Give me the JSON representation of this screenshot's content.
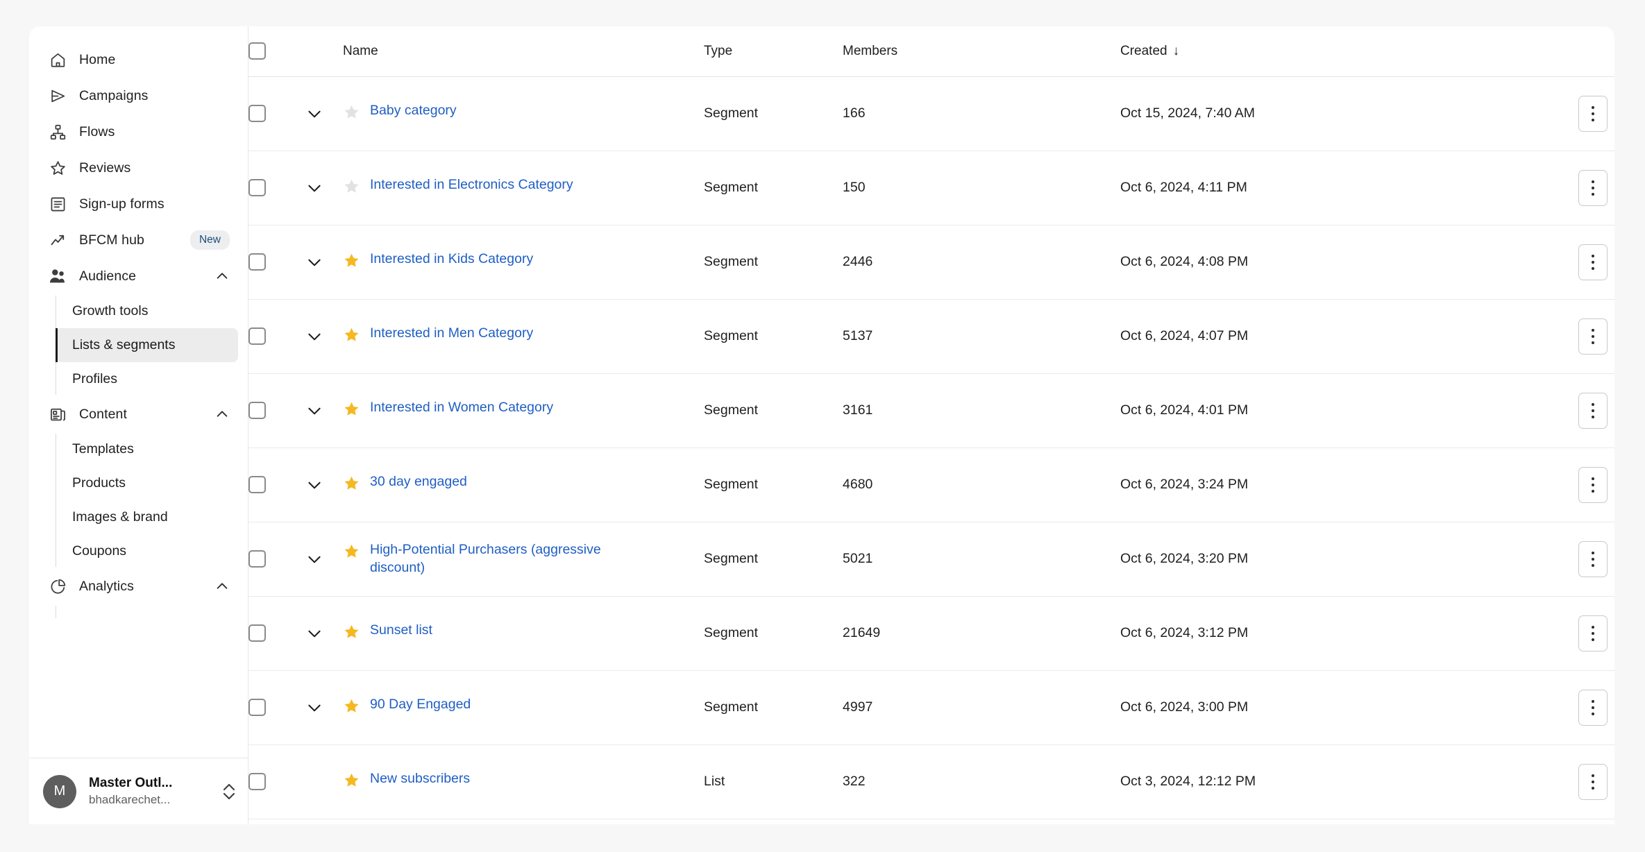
{
  "sidebar": {
    "items": [
      {
        "label": "Home",
        "icon": "home-icon"
      },
      {
        "label": "Campaigns",
        "icon": "campaigns-icon"
      },
      {
        "label": "Flows",
        "icon": "flows-icon"
      },
      {
        "label": "Reviews",
        "icon": "reviews-star-icon"
      },
      {
        "label": "Sign-up forms",
        "icon": "signup-forms-icon"
      },
      {
        "label": "BFCM hub",
        "icon": "trending-up-icon",
        "badge": "New"
      }
    ],
    "groups": [
      {
        "label": "Audience",
        "icon": "audience-people-icon",
        "expanded": true,
        "children": [
          {
            "label": "Growth tools",
            "active": false
          },
          {
            "label": "Lists & segments",
            "active": true
          },
          {
            "label": "Profiles",
            "active": false
          }
        ]
      },
      {
        "label": "Content",
        "icon": "content-icon",
        "expanded": true,
        "children": [
          {
            "label": "Templates",
            "active": false
          },
          {
            "label": "Products",
            "active": false
          },
          {
            "label": "Images & brand",
            "active": false
          },
          {
            "label": "Coupons",
            "active": false
          }
        ]
      },
      {
        "label": "Analytics",
        "icon": "analytics-pie-icon",
        "expanded": true,
        "children": []
      }
    ],
    "account": {
      "avatar_initial": "M",
      "name": "Master Outl...",
      "email": "bhadkarechet..."
    }
  },
  "table": {
    "columns": {
      "name": "Name",
      "type": "Type",
      "members": "Members",
      "created": "Created",
      "sort_arrow": "↓"
    },
    "rows": [
      {
        "name": "Baby category",
        "starred": false,
        "has_chevron": true,
        "type": "Segment",
        "members": "166",
        "created": "Oct 15, 2024, 7:40 AM"
      },
      {
        "name": "Interested in Electronics Category",
        "starred": false,
        "has_chevron": true,
        "type": "Segment",
        "members": "150",
        "created": "Oct 6, 2024, 4:11 PM"
      },
      {
        "name": "Interested in Kids Category",
        "starred": true,
        "has_chevron": true,
        "type": "Segment",
        "members": "2446",
        "created": "Oct 6, 2024, 4:08 PM"
      },
      {
        "name": "Interested in Men Category",
        "starred": true,
        "has_chevron": true,
        "type": "Segment",
        "members": "5137",
        "created": "Oct 6, 2024, 4:07 PM"
      },
      {
        "name": "Interested in Women Category",
        "starred": true,
        "has_chevron": true,
        "type": "Segment",
        "members": "3161",
        "created": "Oct 6, 2024, 4:01 PM"
      },
      {
        "name": "30 day engaged",
        "starred": true,
        "has_chevron": true,
        "type": "Segment",
        "members": "4680",
        "created": "Oct 6, 2024, 3:24 PM"
      },
      {
        "name": "High-Potential Purchasers (aggressive discount)",
        "starred": true,
        "has_chevron": true,
        "type": "Segment",
        "members": "5021",
        "created": "Oct 6, 2024, 3:20 PM"
      },
      {
        "name": "Sunset list",
        "starred": true,
        "has_chevron": true,
        "type": "Segment",
        "members": "21649",
        "created": "Oct 6, 2024, 3:12 PM"
      },
      {
        "name": "90 Day Engaged",
        "starred": true,
        "has_chevron": true,
        "type": "Segment",
        "members": "4997",
        "created": "Oct 6, 2024, 3:00 PM"
      },
      {
        "name": "New subscribers",
        "starred": true,
        "has_chevron": false,
        "type": "List",
        "members": "322",
        "created": "Oct 3, 2024, 12:12 PM"
      }
    ]
  },
  "colors": {
    "link": "#1f5ec4",
    "star_on": "#f5b820",
    "star_off": "#e2e2e2",
    "badge_text": "#1d4f7c",
    "page_bg": "#f7f7f7"
  }
}
